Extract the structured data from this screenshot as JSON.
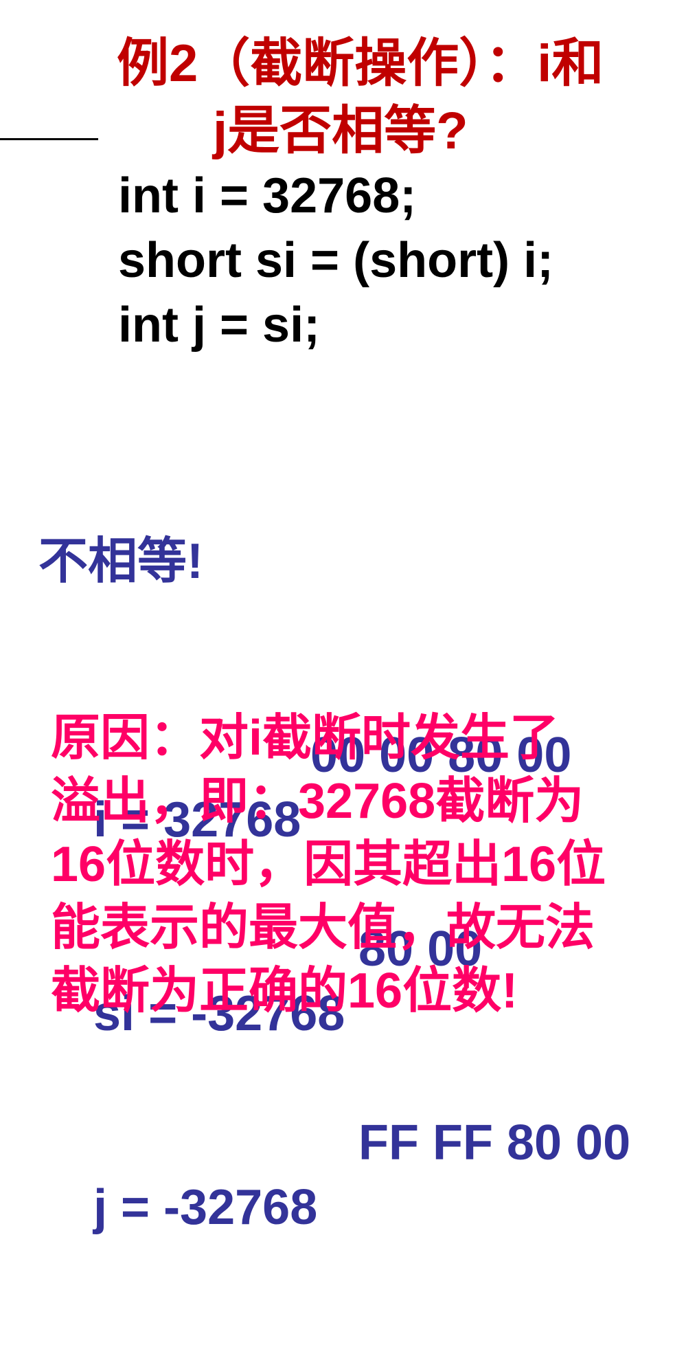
{
  "title": {
    "line1": "例2（截断操作）：i和",
    "line2": "j是否相等?"
  },
  "code": {
    "lines": [
      "int i = 32768;",
      "short si = (short) i;",
      "int j = si;"
    ]
  },
  "answer": {
    "verdict": "不相等!",
    "rows": [
      {
        "label": "i = 32768",
        "hex": "00 00 80 00"
      },
      {
        "label": "si = -32768",
        "hex": "80 00"
      },
      {
        "label": "j = -32768",
        "hex": "FF FF 80 00"
      }
    ]
  },
  "reason": {
    "lines": [
      "原因：对i截断时发生了",
      "溢出，即：32768截断为",
      "16位数时，因其超出16位",
      "能表示的最大值，故无法",
      "截断为正确的16位数!"
    ]
  },
  "colors": {
    "title": "#c00000",
    "code": "#000000",
    "answer": "#333399",
    "reason": "#ff0066"
  }
}
